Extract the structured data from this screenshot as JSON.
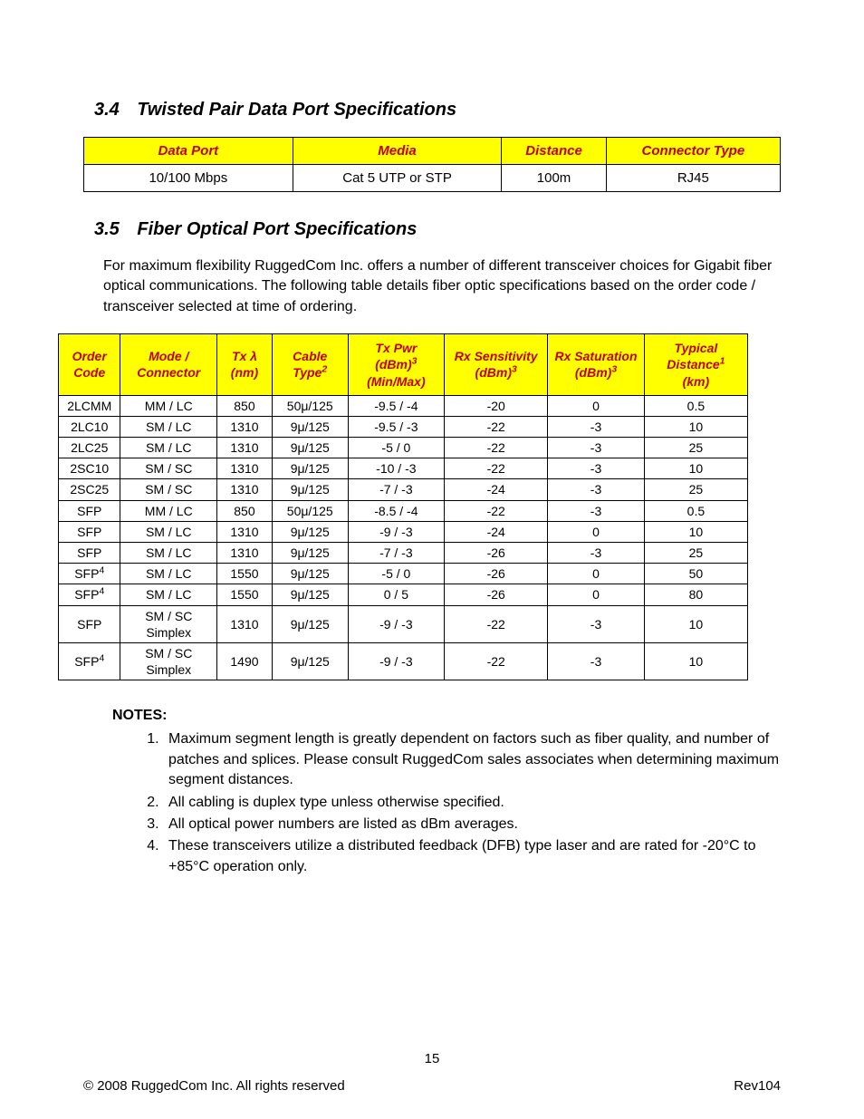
{
  "sections": {
    "s34": {
      "num": "3.4",
      "title": "Twisted Pair Data Port Specifications"
    },
    "s35": {
      "num": "3.5",
      "title": "Fiber Optical Port Specifications"
    }
  },
  "table1": {
    "headers": [
      "Data Port",
      "Media",
      "Distance",
      "Connector Type"
    ],
    "rows": [
      [
        "10/100 Mbps",
        "Cat 5 UTP or STP",
        "100m",
        "RJ45"
      ]
    ]
  },
  "para35": "For maximum flexibility RuggedCom Inc. offers a number of different transceiver choices for Gigabit fiber optical communications.  The following table details fiber optic specifications based on the order code / transceiver selected at time of ordering.",
  "table2": {
    "headers": [
      {
        "h": "Order Code",
        "sup": ""
      },
      {
        "h": "Mode / Connector",
        "sup": ""
      },
      {
        "h": "Tx λ (nm)",
        "sup": ""
      },
      {
        "h": "Cable Type",
        "sup": "2"
      },
      {
        "h": "Tx Pwr (dBm)",
        "sup": "3",
        "tail": " (Min/Max)"
      },
      {
        "h": "Rx Sensitivity (dBm)",
        "sup": "3"
      },
      {
        "h": "Rx Saturation (dBm)",
        "sup": "3"
      },
      {
        "h": "Typical Distance",
        "sup": "1",
        "tail": " (km)"
      }
    ],
    "rows": [
      {
        "c": [
          "2LCMM",
          "MM / LC",
          "850",
          "50μ/125",
          "-9.5 / -4",
          "-20",
          "0",
          "0.5"
        ],
        "ocsup": ""
      },
      {
        "c": [
          "2LC10",
          "SM / LC",
          "1310",
          "9μ/125",
          "-9.5 / -3",
          "-22",
          "-3",
          "10"
        ],
        "ocsup": ""
      },
      {
        "c": [
          "2LC25",
          "SM / LC",
          "1310",
          "9μ/125",
          "-5 / 0",
          "-22",
          "-3",
          "25"
        ],
        "ocsup": ""
      },
      {
        "c": [
          "2SC10",
          "SM / SC",
          "1310",
          "9μ/125",
          "-10 / -3",
          "-22",
          "-3",
          "10"
        ],
        "ocsup": ""
      },
      {
        "c": [
          "2SC25",
          "SM / SC",
          "1310",
          "9μ/125",
          "-7 / -3",
          "-24",
          "-3",
          "25"
        ],
        "ocsup": ""
      },
      {
        "c": [
          "SFP",
          "MM / LC",
          "850",
          "50μ/125",
          "-8.5 / -4",
          "-22",
          "-3",
          "0.5"
        ],
        "ocsup": ""
      },
      {
        "c": [
          "SFP",
          "SM / LC",
          "1310",
          "9μ/125",
          "-9 / -3",
          "-24",
          "0",
          "10"
        ],
        "ocsup": ""
      },
      {
        "c": [
          "SFP",
          "SM / LC",
          "1310",
          "9μ/125",
          "-7 / -3",
          "-26",
          "-3",
          "25"
        ],
        "ocsup": ""
      },
      {
        "c": [
          "SFP",
          "SM / LC",
          "1550",
          "9μ/125",
          "-5 / 0",
          "-26",
          "0",
          "50"
        ],
        "ocsup": "4"
      },
      {
        "c": [
          "SFP",
          "SM / LC",
          "1550",
          "9μ/125",
          "0 / 5",
          "-26",
          "0",
          "80"
        ],
        "ocsup": "4"
      },
      {
        "c": [
          "SFP",
          "SM / SC Simplex",
          "1310",
          "9μ/125",
          "-9 / -3",
          "-22",
          "-3",
          "10"
        ],
        "ocsup": ""
      },
      {
        "c": [
          "SFP",
          "SM / SC Simplex",
          "1490",
          "9μ/125",
          "-9 / -3",
          "-22",
          "-3",
          "10"
        ],
        "ocsup": "4"
      }
    ]
  },
  "notesLabel": "NOTES:",
  "notes": [
    "Maximum segment length is greatly dependent on factors such as fiber quality, and number of patches and splices. Please consult RuggedCom sales associates when determining maximum segment distances.",
    "All cabling is duplex type unless otherwise specified.",
    "All optical power numbers are listed as dBm averages.",
    "These transceivers utilize a distributed feedback (DFB) type laser and are rated for -20°C to +85°C operation only."
  ],
  "pageNumber": "15",
  "footerLeft": "©  2008 RuggedCom Inc. All rights reserved",
  "footerRight": "Rev104"
}
